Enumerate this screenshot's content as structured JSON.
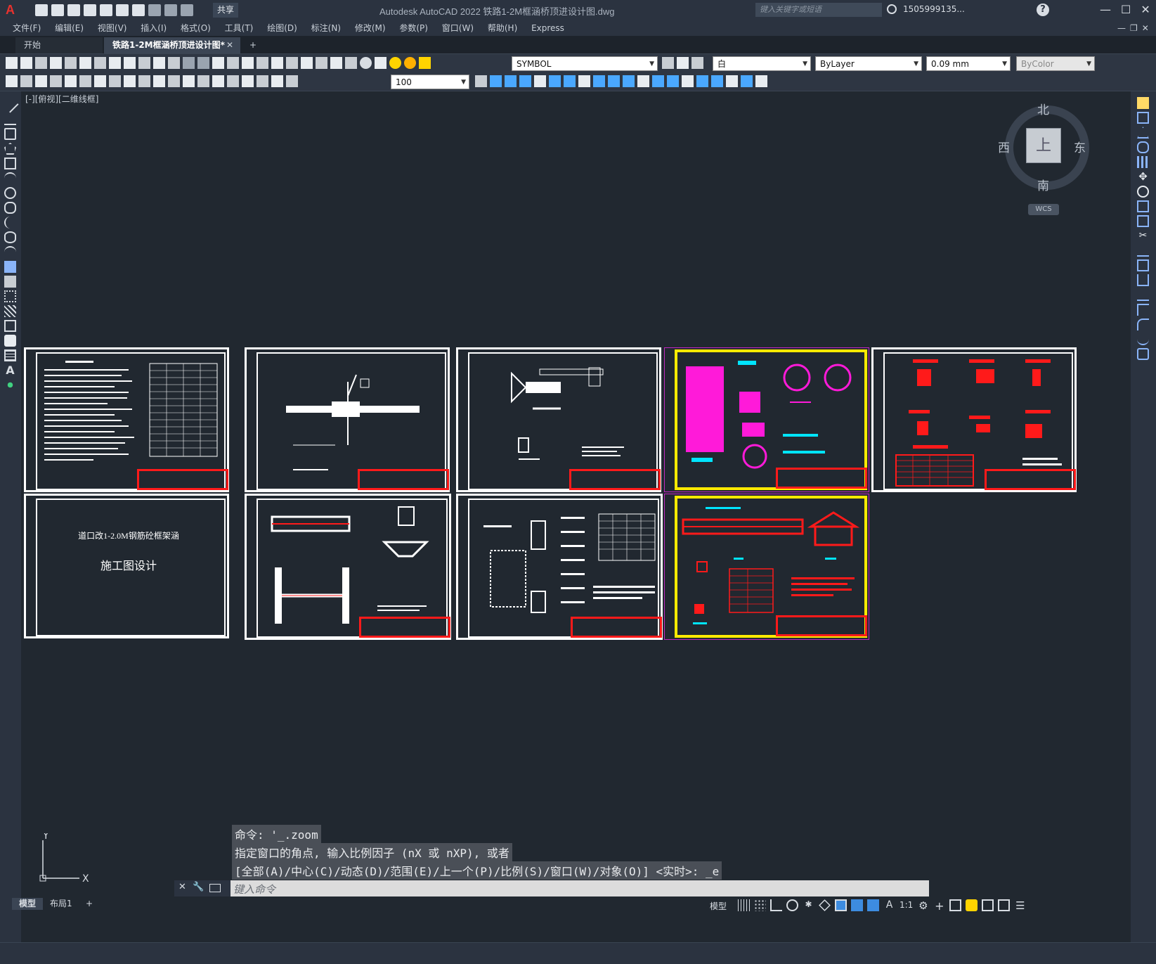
{
  "titlebar": {
    "app_logo": "A",
    "share_label": "共享",
    "window_title": "Autodesk AutoCAD 2022    铁路1-2M框涵桥顶进设计图.dwg",
    "search_placeholder": "键入关键字或短语",
    "user": "1505999135...",
    "help": "?",
    "min": "—",
    "max": "☐",
    "close": "✕"
  },
  "menubar": {
    "items": [
      "文件(F)",
      "编辑(E)",
      "视图(V)",
      "插入(I)",
      "格式(O)",
      "工具(T)",
      "绘图(D)",
      "标注(N)",
      "修改(M)",
      "参数(P)",
      "窗口(W)",
      "帮助(H)",
      "Express"
    ],
    "mdi_controls": "—❐✕"
  },
  "tabs": {
    "start": "开始",
    "active": "铁路1-2M框涵桥顶进设计图*",
    "close": "✕",
    "add": "+"
  },
  "toolbar": {
    "layer_name": "SYMBOL",
    "color": "白",
    "linetype": "ByLayer",
    "lineweight": "0.09 mm",
    "plotstyle": "ByColor",
    "dimscale": "100"
  },
  "viewport": {
    "label": "[-][俯视][二维线框]",
    "viewcube": {
      "top": "上",
      "north": "北",
      "south": "南",
      "east": "东",
      "west": "西",
      "wcs": "WCS"
    },
    "sheet_texts": {
      "cover_line1": "道口改1-2.0M钢筋砼框架涵",
      "cover_line2": "施工图设计"
    }
  },
  "command": {
    "history": [
      "命令: '_.zoom",
      "指定窗口的角点, 输入比例因子 (nX 或 nXP), 或者",
      "[全部(A)/中心(C)/动态(D)/范围(E)/上一个(P)/比例(S)/窗口(W)/对象(O)] <实时>: _e"
    ],
    "prompt_placeholder": "键入命令"
  },
  "ucs": {
    "x": "X",
    "y": "Y"
  },
  "statusbar": {
    "tabs": [
      "模型",
      "布局1"
    ],
    "add": "+",
    "mode": "模型",
    "scale": "1:1"
  }
}
